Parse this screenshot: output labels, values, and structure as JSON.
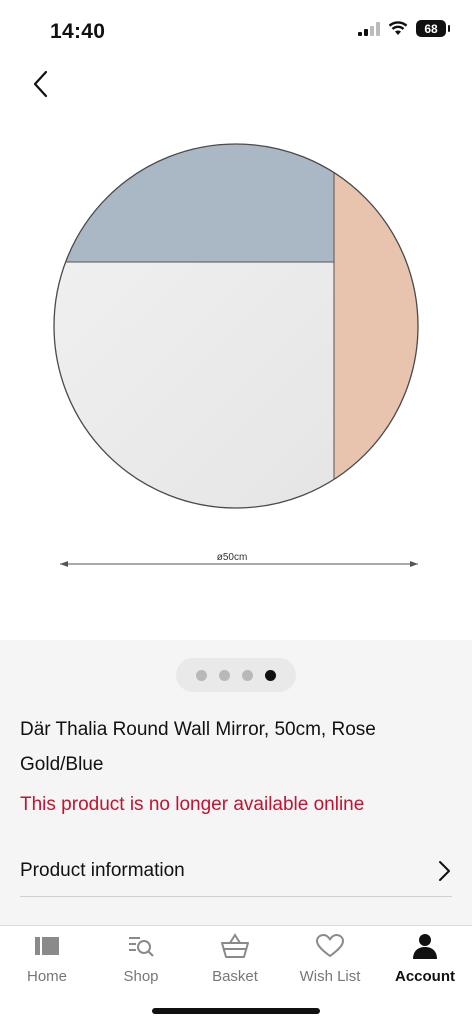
{
  "status_bar": {
    "time": "14:40",
    "battery": "68"
  },
  "product": {
    "dimension_label": "ø50cm",
    "title": "Där Thalia Round Wall Mirror, 50cm, Rose Gold/Blue",
    "availability": "This product is no longer available online",
    "info_label": "Product information",
    "image_count": 4,
    "active_image": 4
  },
  "colors": {
    "alert": "#c41230",
    "mirror_blue": "#a9b8c4",
    "mirror_rose": "#e8c4ae"
  },
  "tabs": [
    {
      "label": "Home",
      "icon": "home-icon"
    },
    {
      "label": "Shop",
      "icon": "shop-search-icon"
    },
    {
      "label": "Basket",
      "icon": "basket-icon"
    },
    {
      "label": "Wish List",
      "icon": "heart-icon"
    },
    {
      "label": "Account",
      "icon": "account-icon",
      "active": true
    }
  ]
}
